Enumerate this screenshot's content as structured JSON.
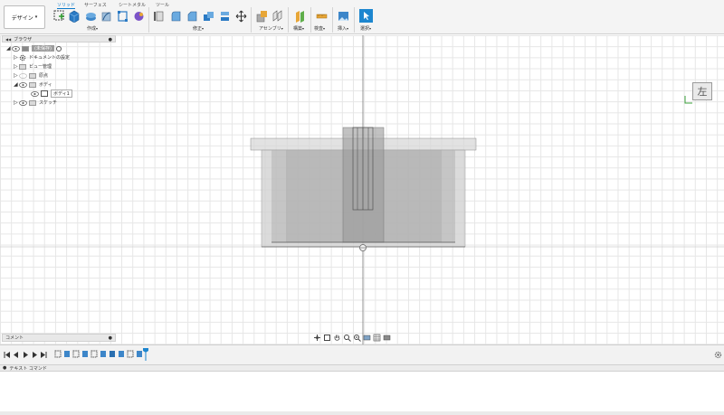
{
  "toolbar": {
    "workspace_label": "デザイン",
    "workspace_caret": "▾",
    "tabs": [
      {
        "label": "ソリッド",
        "active": true
      },
      {
        "label": "サーフェス",
        "active": false
      },
      {
        "label": "シートメタル",
        "active": false
      },
      {
        "label": "ツール",
        "active": false
      }
    ],
    "groups": [
      {
        "label": "作成",
        "caret": "▾"
      },
      {
        "label": "修正",
        "caret": "▾"
      },
      {
        "label": "アセンブリ",
        "caret": "▾"
      },
      {
        "label": "構築",
        "caret": "▾"
      },
      {
        "label": "検査",
        "caret": "▾"
      },
      {
        "label": "挿入",
        "caret": "▾"
      },
      {
        "label": "選択",
        "caret": "▾"
      }
    ],
    "accent_color": "#0a78c8"
  },
  "browser": {
    "title": "ブラウザ",
    "collapse_glyph": "◀◀",
    "items": {
      "root": "(未保存)",
      "doc_settings": "ドキュメントの設定",
      "named_views": "ビュー管理",
      "origin": "原点",
      "bodies": "ボディ",
      "body1": "ボディ1",
      "sketches": "スケッチ"
    }
  },
  "viewcube": {
    "face_label": "左"
  },
  "comments": {
    "title": "コメント"
  },
  "textcmd": {
    "title": "テキスト コマンド"
  }
}
